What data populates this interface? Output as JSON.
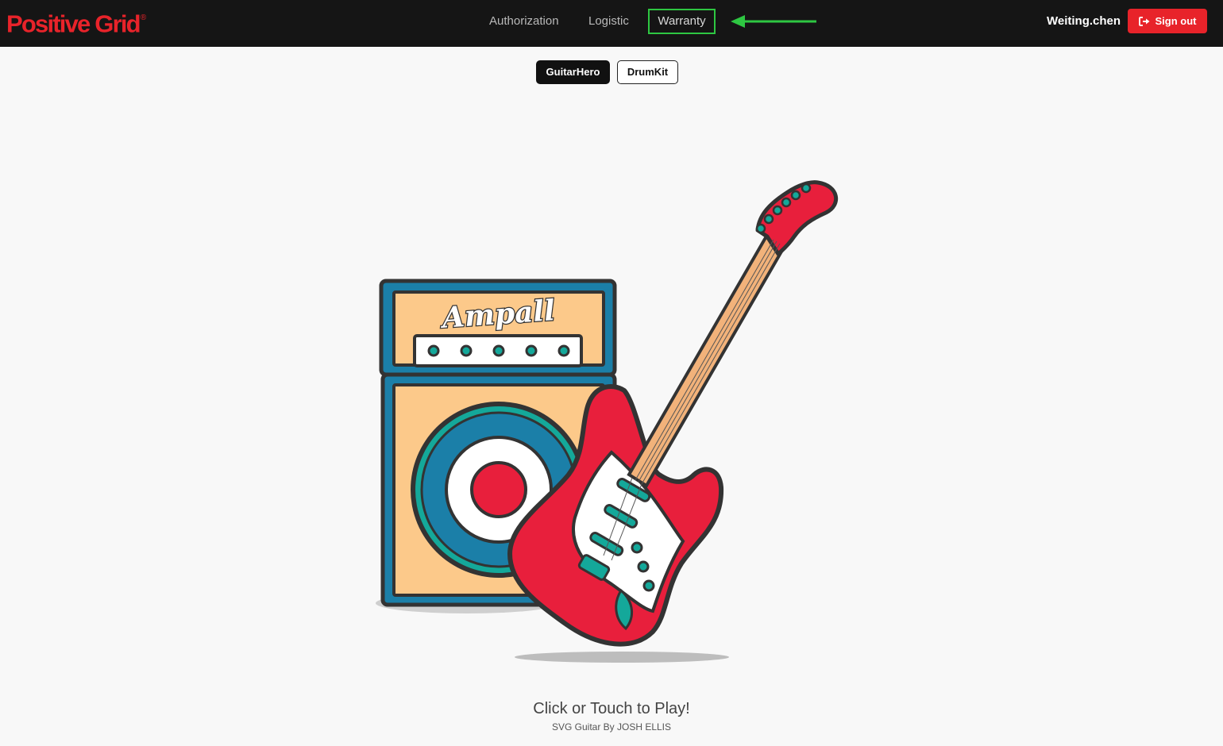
{
  "brand": {
    "logo_text": "Positive Grid",
    "logo_mark": "®",
    "accent": "#e8232a"
  },
  "nav": {
    "links": [
      {
        "label": "Authorization"
      },
      {
        "label": "Logistic"
      },
      {
        "label": "Warranty",
        "highlighted": true
      }
    ]
  },
  "user": {
    "name": "Weiting.chen",
    "signout_label": "Sign out",
    "signout_icon": "sign-out-icon"
  },
  "modes": {
    "guitar": "GuitarHero",
    "drum": "DrumKit",
    "selected": "GuitarHero"
  },
  "illustration": {
    "amp_label": "Ampall"
  },
  "footer": {
    "cta": "Click or Touch to Play!",
    "credit": "SVG Guitar By JOSH ELLIS"
  },
  "colors": {
    "highlight": "#2ec742",
    "amp_blue": "#1b7fa8",
    "amp_tan": "#fcc98a",
    "teal": "#14a89a",
    "guitar_red": "#e81f3c"
  }
}
